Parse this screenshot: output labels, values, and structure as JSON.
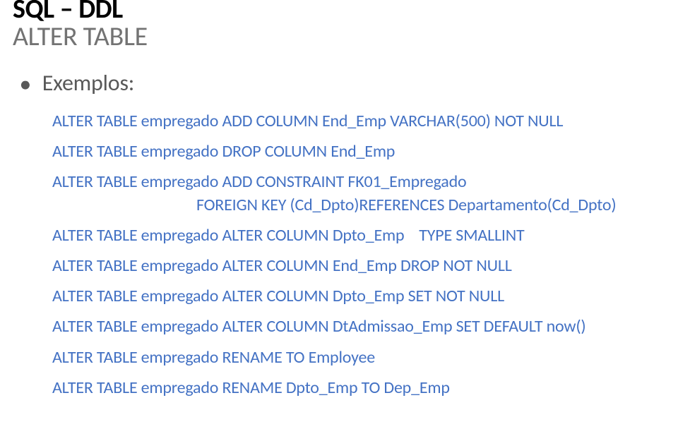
{
  "title": "SQL – DDL",
  "subtitle": "ALTER TABLE",
  "bullet_label": "Exemplos:",
  "code_lines": [
    {
      "text": "ALTER TABLE empregado ADD COLUMN End_Emp VARCHAR(500) NOT NULL",
      "indented": false,
      "gap_after": true
    },
    {
      "text": "ALTER TABLE empregado DROP COLUMN End_Emp",
      "indented": false,
      "gap_after": true
    },
    {
      "text": "ALTER TABLE empregado ADD CONSTRAINT FK01_Empregado",
      "indented": false,
      "gap_after": false
    },
    {
      "text": "FOREIGN KEY (Cd_Dpto)REFERENCES Departamento(Cd_Dpto)",
      "indented": true,
      "gap_after": true
    },
    {
      "text": "ALTER TABLE empregado ALTER COLUMN Dpto_Emp    TYPE SMALLINT",
      "indented": false,
      "gap_after": true
    },
    {
      "text": "ALTER TABLE empregado ALTER COLUMN End_Emp DROP NOT NULL",
      "indented": false,
      "gap_after": true
    },
    {
      "text": "ALTER TABLE empregado ALTER COLUMN Dpto_Emp SET NOT NULL",
      "indented": false,
      "gap_after": true
    },
    {
      "text": "ALTER TABLE empregado ALTER COLUMN DtAdmissao_Emp SET DEFAULT now()",
      "indented": false,
      "gap_after": true
    },
    {
      "text": "ALTER TABLE empregado RENAME TO Employee",
      "indented": false,
      "gap_after": true
    },
    {
      "text": "ALTER TABLE empregado RENAME Dpto_Emp TO Dep_Emp",
      "indented": false,
      "gap_after": false
    }
  ]
}
